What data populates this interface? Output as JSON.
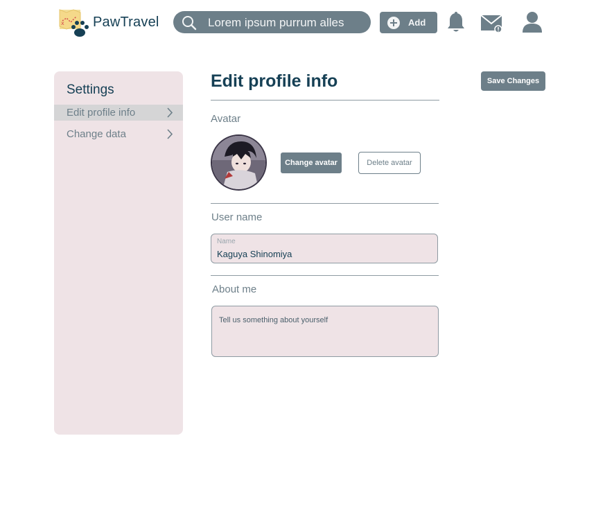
{
  "header": {
    "brand": "PawTravel",
    "search_text": "Lorem ipsum purrum alles",
    "add_label": "Add"
  },
  "sidebar": {
    "title": "Settings",
    "items": [
      {
        "label": "Edit profile info",
        "active": true
      },
      {
        "label": "Change data",
        "active": false
      }
    ]
  },
  "main": {
    "title": "Edit profile info",
    "save_label": "Save Changes",
    "avatar": {
      "label": "Avatar",
      "change_label": "Change avatar",
      "delete_label": "Delete avatar"
    },
    "username": {
      "label": "User name",
      "field_label": "Name",
      "value": "Kaguya Shinomiya"
    },
    "about": {
      "label": "About me",
      "placeholder": "Tell us something about yourself"
    }
  },
  "colors": {
    "accent": "#6d7f89",
    "title": "#164055",
    "panel_bg": "#efe3e6",
    "active_item_bg": "#d5d5d6"
  },
  "icons": {
    "logo": "map-paw-logo-icon",
    "search": "search-icon",
    "add": "plus-circle-icon",
    "notifications": "bell-icon",
    "messages": "mail-icon",
    "profile": "user-icon",
    "chevron": "chevron-right-icon"
  }
}
